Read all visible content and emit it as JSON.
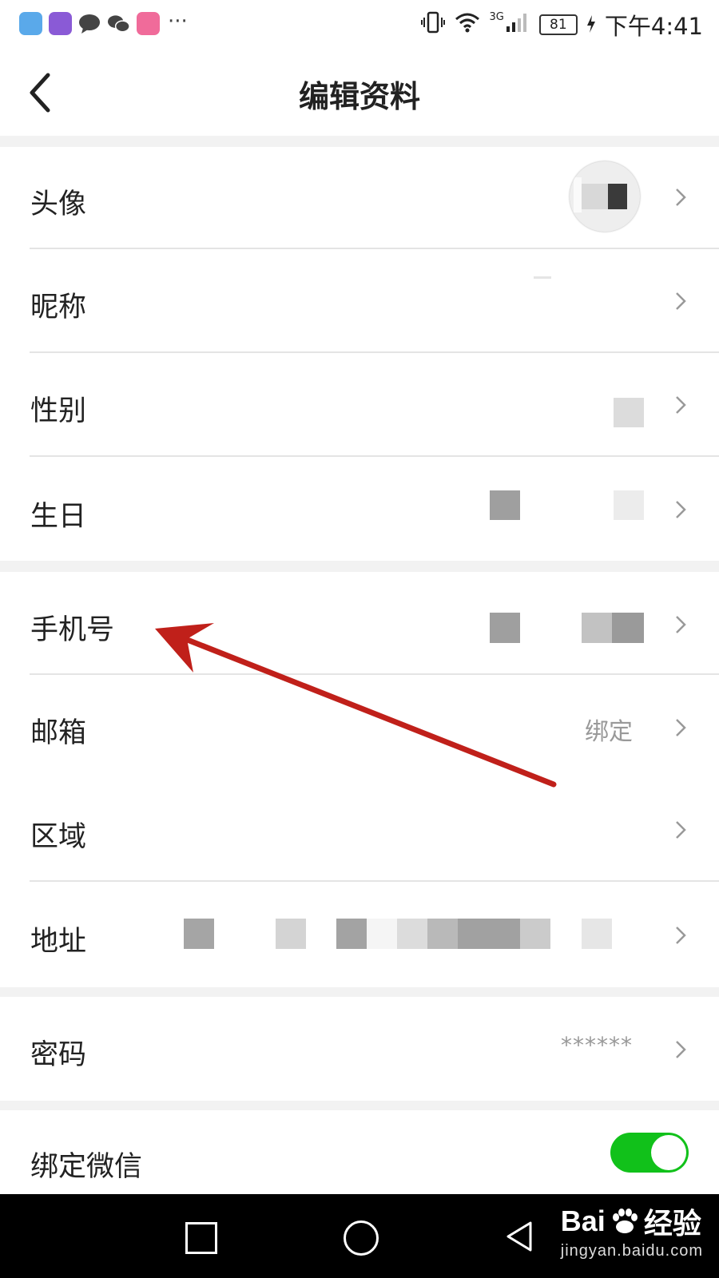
{
  "status_bar": {
    "time": "下午4:41",
    "battery": "81",
    "network": "3G",
    "more": "···"
  },
  "header": {
    "title": "编辑资料"
  },
  "rows": [
    {
      "label": "头像"
    },
    {
      "label": "昵称"
    },
    {
      "label": "性别"
    },
    {
      "label": "生日"
    },
    {
      "label": "手机号"
    },
    {
      "label": "邮箱",
      "value": "绑定"
    },
    {
      "label": "区域"
    },
    {
      "label": "地址"
    },
    {
      "label": "密码",
      "value": "******"
    },
    {
      "label": "绑定微信",
      "toggle_on": true
    }
  ],
  "watermark": {
    "brand": "Bai",
    "brand2": "经验",
    "sub": "jingyan.baidu.com"
  },
  "colors": {
    "accent_toggle": "#11c11a",
    "arrow": "#c0201a",
    "section_gap": "#f2f2f2"
  }
}
